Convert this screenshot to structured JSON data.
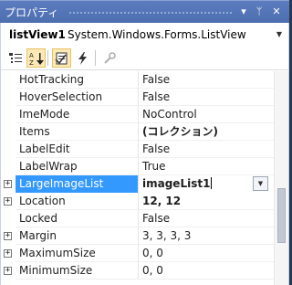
{
  "window": {
    "title": "プロパティ",
    "pin_glyph": "▾",
    "autohide_glyph": "ᛘ",
    "close_glyph": "✕"
  },
  "object_selector": {
    "name": "listView1",
    "type": "System.Windows.Forms.ListView"
  },
  "toolbar": {
    "buttons": [
      {
        "icon": "categorized-icon",
        "active": false
      },
      {
        "icon": "alphabetical-icon",
        "active": true
      },
      {
        "icon": "properties-icon",
        "active": true
      },
      {
        "icon": "events-icon",
        "active": false
      },
      {
        "icon": "property-pages-icon",
        "active": false
      }
    ]
  },
  "properties": [
    {
      "name": "HotTracking",
      "value": "False",
      "expandable": false,
      "bold": false
    },
    {
      "name": "HoverSelection",
      "value": "False",
      "expandable": false,
      "bold": false
    },
    {
      "name": "ImeMode",
      "value": "NoControl",
      "expandable": false,
      "bold": false
    },
    {
      "name": "Items",
      "value": "(コレクション)",
      "expandable": false,
      "bold": true
    },
    {
      "name": "LabelEdit",
      "value": "False",
      "expandable": false,
      "bold": false
    },
    {
      "name": "LabelWrap",
      "value": "True",
      "expandable": false,
      "bold": false
    },
    {
      "name": "LargeImageList",
      "value": "imageList1",
      "expandable": true,
      "bold": true,
      "selected": true
    },
    {
      "name": "Location",
      "value": "12, 12",
      "expandable": true,
      "bold": true
    },
    {
      "name": "Locked",
      "value": "False",
      "expandable": false,
      "bold": false
    },
    {
      "name": "Margin",
      "value": "3, 3, 3, 3",
      "expandable": true,
      "bold": false
    },
    {
      "name": "MaximumSize",
      "value": "0, 0",
      "expandable": true,
      "bold": false
    },
    {
      "name": "MinimumSize",
      "value": "0, 0",
      "expandable": true,
      "bold": false
    }
  ],
  "colors": {
    "title_bar": "#4d6eaf",
    "selection": "#3399ff",
    "toolbar_active": "#fde9b6"
  }
}
